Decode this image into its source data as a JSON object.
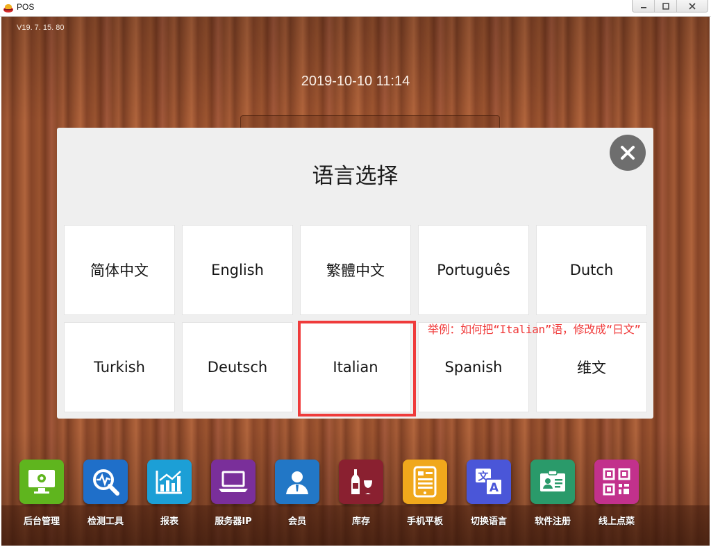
{
  "window": {
    "title": "POS"
  },
  "app": {
    "version": "V19. 7. 15. 80",
    "datetime": "2019-10-10 11:14"
  },
  "dialog": {
    "title": "语言选择",
    "languages": [
      "简体中文",
      "English",
      "繁體中文",
      "Português",
      "Dutch",
      "Turkish",
      "Deutsch",
      "Italian",
      "Spanish",
      "维文"
    ],
    "highlighted": "Italian"
  },
  "annotation": "举例：如何把“Italian”语，修改成“日文”",
  "toolbar": {
    "items": [
      {
        "label": "后台管理",
        "icon": "monitor-gear-icon",
        "color": "#5fb51e"
      },
      {
        "label": "检测工具",
        "icon": "magnifier-pulse-icon",
        "color": "#1f6fc9"
      },
      {
        "label": "报表",
        "icon": "chart-icon",
        "color": "#1c9fd6"
      },
      {
        "label": "服务器IP",
        "icon": "laptop-icon",
        "color": "#7a2f9a"
      },
      {
        "label": "会员",
        "icon": "member-icon",
        "color": "#2277c6"
      },
      {
        "label": "库存",
        "icon": "wine-icon",
        "color": "#8a2030"
      },
      {
        "label": "手机平板",
        "icon": "tablet-icon",
        "color": "#f0a81c"
      },
      {
        "label": "切换语言",
        "icon": "translate-icon",
        "color": "#4a56d8"
      },
      {
        "label": "软件注册",
        "icon": "id-card-icon",
        "color": "#2a9a6a"
      },
      {
        "label": "线上点菜",
        "icon": "qr-code-icon",
        "color": "#c2318c"
      }
    ]
  }
}
